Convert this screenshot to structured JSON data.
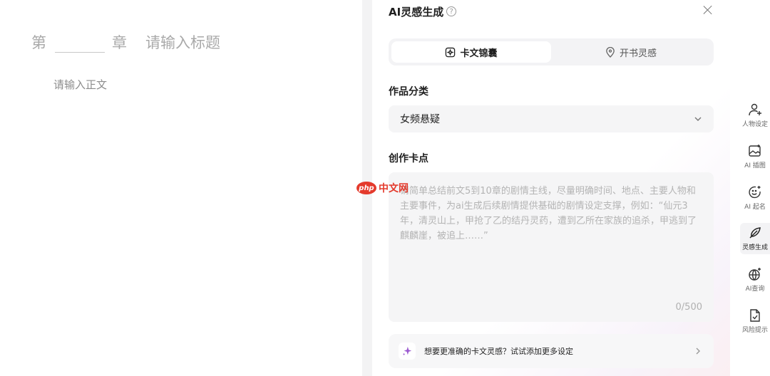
{
  "editor": {
    "chapter_prefix": "第",
    "chapter_suffix": "章",
    "title_placeholder": "请输入标题",
    "body_placeholder": "请输入正文"
  },
  "panel": {
    "title": "AI灵感生成",
    "help_icon": "?",
    "tabs": [
      {
        "label": "卡文锦囊",
        "icon": "sparkle-box-icon",
        "active": true
      },
      {
        "label": "开书灵感",
        "icon": "location-pin-icon",
        "active": false
      }
    ],
    "category": {
      "label": "作品分类",
      "selected": "女频悬疑"
    },
    "stuck_point": {
      "label": "创作卡点",
      "placeholder": "请简单总结前文5到10章的剧情主线，尽量明确时间、地点、主要人物和主要事件，为ai生成后续剧情提供基础的剧情设定支撑，例如：“仙元3年，清灵山上，甲抢了乙的结丹灵药，遭到乙所在家族的追杀，甲逃到了麒麟崖，被追上……”",
      "counter": "0/500"
    },
    "tip": {
      "text": "想要更准确的卡文灵感？试试添加更多设定",
      "icon": "sparkle-icon"
    }
  },
  "watermark": {
    "badge": "php",
    "text": "中文网"
  },
  "rail": {
    "items": [
      {
        "label": "人物设定",
        "icon": "person-add-icon"
      },
      {
        "label": "AI 插图",
        "icon": "image-ai-icon"
      },
      {
        "label": "AI 起名",
        "icon": "smile-ai-icon"
      },
      {
        "label": "灵感生成",
        "icon": "feather-icon"
      },
      {
        "label": "AI查询",
        "icon": "globe-ai-icon"
      },
      {
        "label": "风险提示",
        "icon": "file-check-icon"
      }
    ]
  },
  "colors": {
    "accent": "#9b59d0",
    "watermark_red": "#e43a2c"
  }
}
